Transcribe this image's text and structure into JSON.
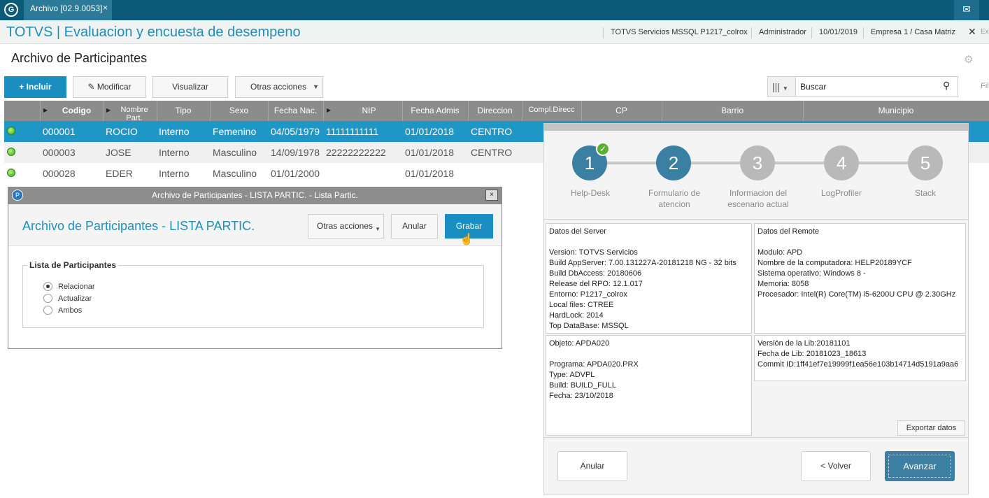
{
  "topbar": {
    "logo": "G",
    "tab": "Archivo [02.9.0053]",
    "tab_close": "×",
    "mail_icon": "✉"
  },
  "header": {
    "title": "TOTVS | Evaluacion y encuesta de desempeno",
    "server": "TOTVS Servicios MSSQL P1217_colrox",
    "user": "Administrador",
    "date": "10/01/2019",
    "company": "Empresa 1 / Casa Matriz",
    "close": "✕",
    "exit": "Ex"
  },
  "page": {
    "title": "Archivo de Participantes",
    "gear": "⚙"
  },
  "toolbar": {
    "incluir": "+ Incluir",
    "modificar": "Modificar",
    "visualizar": "Visualizar",
    "otras": "Otras acciones",
    "search": "Buscar",
    "filter": "Filt"
  },
  "grid": {
    "columns": [
      "Codigo",
      "Nombre Part.",
      "Tipo",
      "Sexo",
      "Fecha Nac.",
      "NIP",
      "Fecha Admis",
      "Direccion",
      "Compl.Direcc",
      "CP",
      "Barrio",
      "Municipio"
    ],
    "rows": [
      [
        "000001",
        "ROCIO",
        "Interno",
        "Femenino",
        "04/05/1979",
        "11111111111",
        "01/01/2018",
        "CENTRO"
      ],
      [
        "000003",
        "JOSE",
        "Interno",
        "Masculino",
        "14/09/1978",
        "22222222222",
        "01/01/2018",
        "CENTRO"
      ],
      [
        "000028",
        "EDER",
        "Interno",
        "Masculino",
        "01/01/2000",
        "",
        "01/01/2018",
        ""
      ]
    ]
  },
  "dialog": {
    "titlebar": "Archivo de Participantes - LISTA PARTIC. - Lista Partic.",
    "close": "×",
    "heading": "Archivo de Participantes - LISTA PARTIC.",
    "otras": "Otras acciones",
    "anular": "Anular",
    "grabar": "Grabar",
    "group": "Lista de Participantes",
    "options": [
      "Relacionar",
      "Actualizar",
      "Ambos"
    ],
    "selected": "Relacionar"
  },
  "wizard": {
    "steps": [
      {
        "num": "1",
        "label": "Help-Desk"
      },
      {
        "num": "2",
        "label": "Formulario de atencion"
      },
      {
        "num": "3",
        "label": "Informacion del escenario actual"
      },
      {
        "num": "4",
        "label": "LogProfiler"
      },
      {
        "num": "5",
        "label": "Stack"
      }
    ],
    "check": "✓",
    "server": [
      "Datos del Server",
      "",
      "Version: TOTVS Servicios",
      "Build AppServer: 7.00.131227A-20181218 NG - 32 bits",
      "Build DbAccess: 20180606",
      "Release del RPO:  12.1.017",
      "Entorno: P1217_colrox",
      "Local files: CTREE",
      "HardLock: 2014",
      "Top DataBase: MSSQL"
    ],
    "remote": [
      "Datos del Remote",
      "",
      "Modulo: APD",
      "Nombre de la computadora: HELP20189YCF",
      "Sistema operativo: Windows 8 -",
      "Memoria: 8058",
      "Procesador: Intel(R) Core(TM) i5-6200U CPU @ 2.30GHz"
    ],
    "objeto": [
      "Objeto: APDA020",
      "",
      "Programa: APDA020.PRX",
      "Type: ADVPL",
      "Build: BUILD_FULL",
      "Fecha: 23/10/2018"
    ],
    "lib": [
      "Versión de la Lib:20181101",
      "Fecha de Lib: 20181023_18613",
      "Commit ID:1ff41ef7e19999f1ea56e103b14714d5191a9aa6"
    ],
    "exportar": "Exportar datos",
    "anular": "Anular",
    "volver": "< Volver",
    "avanzar": "Avanzar"
  }
}
